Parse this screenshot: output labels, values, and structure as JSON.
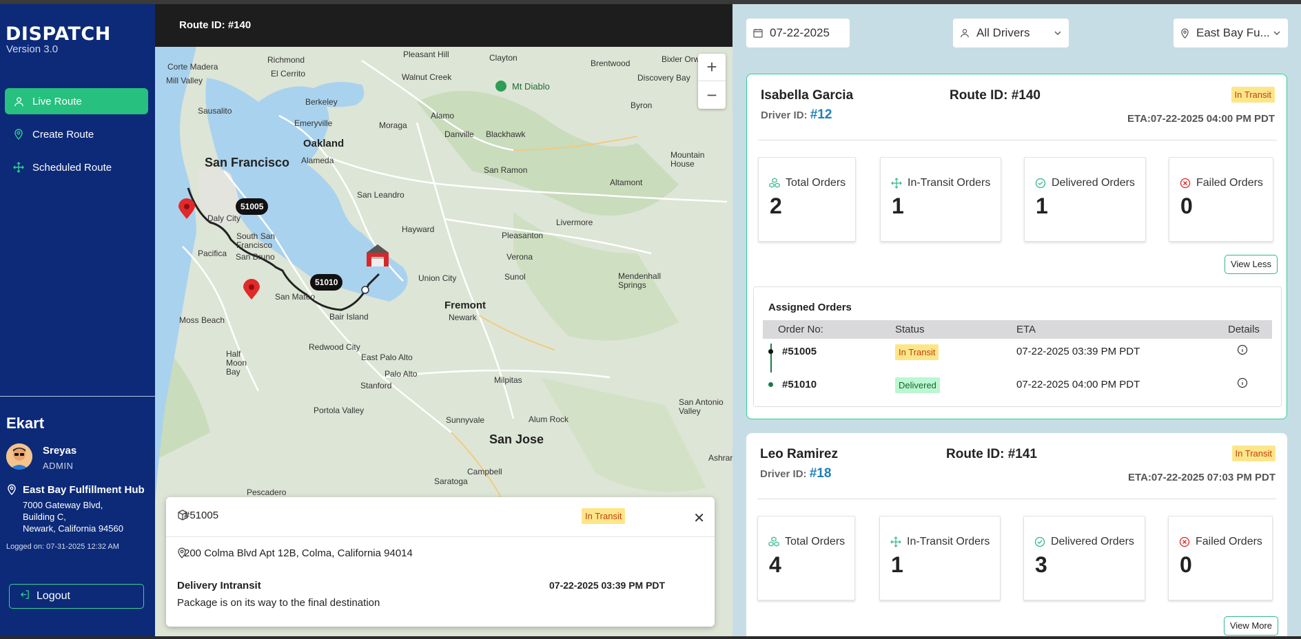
{
  "sidebar": {
    "brand": "DISPATCH",
    "version": "Version 3.0",
    "nav": [
      {
        "label": "Live Route",
        "icon": "user-route-icon",
        "active": true
      },
      {
        "label": "Create Route",
        "icon": "location-pin-icon",
        "active": false
      },
      {
        "label": "Scheduled Route",
        "icon": "move-arrows-icon",
        "active": false
      }
    ],
    "org": "Ekart",
    "user": {
      "name": "Sreyas",
      "role": "ADMIN"
    },
    "hub": {
      "name": "East Bay Fulfillment Hub",
      "addr1": "7000 Gateway Blvd,",
      "addr2": "Building C,",
      "addr3": "Newark, California 94560"
    },
    "logged_on": "Logged on: 07-31-2025 12:32 AM",
    "logout": "Logout"
  },
  "map": {
    "header": "Route ID: #140",
    "zoom_in": "+",
    "zoom_out": "−",
    "pins": [
      {
        "label": "51005"
      },
      {
        "label": "51010"
      }
    ],
    "places": [
      "Corte Madera",
      "Richmond",
      "Pleasant Hill",
      "Clayton",
      "Brentwood",
      "Bixler Orwood",
      "Mill Valley",
      "El Cerrito",
      "Walnut Creek",
      "Mt Diablo",
      "Discovery Bay",
      "Sausalito",
      "Berkeley",
      "Byron",
      "Emeryville",
      "Moraga",
      "Alamo",
      "Oakland",
      "Danville",
      "Blackhawk",
      "San Francisco",
      "Alameda",
      "San Ramon",
      "Mountain House",
      "Altamont",
      "San Leandro",
      "Daly City",
      "Livermore",
      "Hayward",
      "South San Francisco",
      "Pleasanton",
      "San Bruno",
      "Pacifica",
      "Verona",
      "Sunol",
      "Union City",
      "Mendenhall Springs",
      "San Mateo",
      "Fremont",
      "Moss Beach",
      "Bair Island",
      "Newark",
      "Redwood City",
      "East Palo Alto",
      "Half Moon Bay",
      "Palo Alto",
      "Milpitas",
      "Stanford",
      "Portola Valley",
      "Sunnyvale",
      "Alum Rock",
      "San Antonio Valley",
      "San Jose",
      "Campbell",
      "Ashrar",
      "Saratoga",
      "Pescadero"
    ],
    "popup": {
      "order": "#51005",
      "status": "In Transit",
      "address": "200 Colma Blvd Apt 12B, Colma, California 94014",
      "delivery_status": "Delivery Intransit",
      "time": "07-22-2025 03:39 PM PDT",
      "message": "Package is on its way to the final destination"
    }
  },
  "filters": {
    "date": "07-22-2025",
    "drivers": "All Drivers",
    "hub": "East Bay Fu..."
  },
  "routes": [
    {
      "driver": "Isabella Garcia",
      "driver_id_label": "Driver ID:",
      "driver_id": "#12",
      "route_id": "Route ID: #140",
      "status": "In Transit",
      "eta": "ETA:07-22-2025 04:00 PM PDT",
      "stats": [
        {
          "label": "Total Orders",
          "value": "2",
          "icon": "boxes-icon"
        },
        {
          "label": "In-Transit Orders",
          "value": "1",
          "icon": "move-arrows-icon"
        },
        {
          "label": "Delivered Orders",
          "value": "1",
          "icon": "check-circle-icon"
        },
        {
          "label": "Failed Orders",
          "value": "0",
          "icon": "x-circle-icon"
        }
      ],
      "toggle": "View Less",
      "assigned": {
        "title": "Assigned Orders",
        "headers": [
          "Order No:",
          "Status",
          "ETA",
          "Details"
        ],
        "rows": [
          {
            "order": "#51005",
            "status": "In Transit",
            "eta": "07-22-2025 03:39 PM PDT"
          },
          {
            "order": "#51010",
            "status": "Delivered",
            "eta": "07-22-2025 04:00 PM PDT"
          }
        ]
      }
    },
    {
      "driver": "Leo Ramirez",
      "driver_id_label": "Driver ID:",
      "driver_id": "#18",
      "route_id": "Route ID: #141",
      "status": "In Transit",
      "eta": "ETA:07-22-2025 07:03 PM PDT",
      "stats": [
        {
          "label": "Total Orders",
          "value": "4",
          "icon": "boxes-icon"
        },
        {
          "label": "In-Transit Orders",
          "value": "1",
          "icon": "move-arrows-icon"
        },
        {
          "label": "Delivered Orders",
          "value": "3",
          "icon": "check-circle-icon"
        },
        {
          "label": "Failed Orders",
          "value": "0",
          "icon": "x-circle-icon"
        }
      ],
      "toggle": "View More"
    }
  ],
  "colors": {
    "sidebar": "#0c2a78",
    "accent": "#27c07f",
    "transit_bg": "#fde68a",
    "delivered_bg": "#bbf7d0"
  }
}
